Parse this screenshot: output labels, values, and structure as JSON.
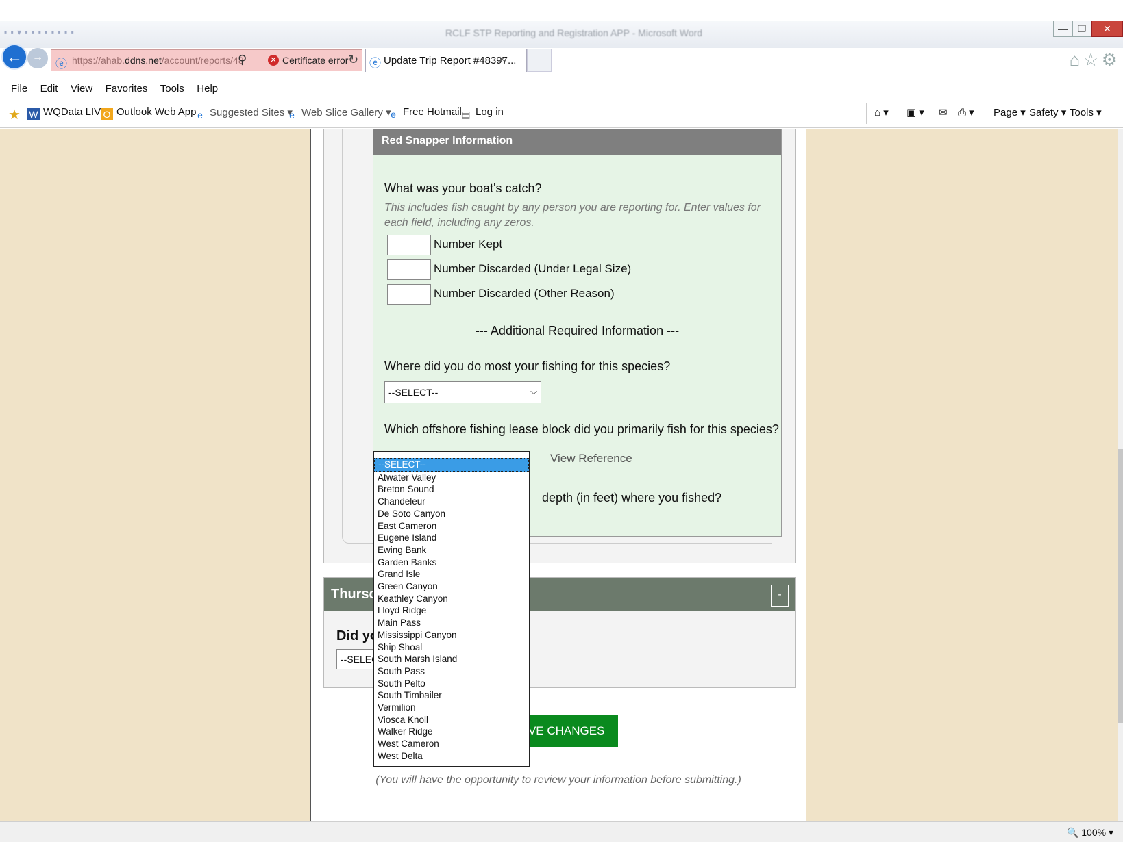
{
  "window": {
    "title": "RCLF STP Reporting and Registration APP - Microsoft Word",
    "buttons": {
      "minimize": "—",
      "restore": "❐",
      "close": "✕"
    }
  },
  "address": {
    "url_host_prefix": "https://ahab.",
    "url_host": "ddns.net",
    "url_path": "/account/reports/48",
    "cert_error": "Certificate error"
  },
  "tab": {
    "label": "Update Trip Report #48397...",
    "close": "×"
  },
  "menu": [
    "File",
    "Edit",
    "View",
    "Favorites",
    "Tools",
    "Help"
  ],
  "favorites": [
    {
      "label": "WQData LIVE",
      "icon": "W"
    },
    {
      "label": "Outlook Web App",
      "icon": "O"
    },
    {
      "label": "Suggested Sites ▾",
      "icon": "e"
    },
    {
      "label": "Web Slice Gallery ▾",
      "icon": "e"
    },
    {
      "label": "Free Hotmail",
      "icon": "e"
    },
    {
      "label": "Log in",
      "icon": "▤"
    }
  ],
  "commands": {
    "page": "Page ▾",
    "safety": "Safety ▾",
    "tools": "Tools ▾"
  },
  "species_panel": {
    "title": "Red Snapper Information",
    "catch_question": "What was your boat's catch?",
    "catch_help": "This includes fish caught by any person you are reporting for. Enter values for each field, including any zeros.",
    "fields": {
      "kept": "Number Kept",
      "discarded_legal": "Number Discarded (Under Legal Size)",
      "discarded_other": "Number Discarded (Other Reason)"
    },
    "additional_header": "--- Additional Required Information ---",
    "area_question": "Where did you do most your fishing for this species?",
    "area_select": "--SELECT--",
    "lease_question": "Which offshore fishing lease block did you primarily fish for this species?",
    "view_reference": "View Reference",
    "depth_question_partial": "depth (in feet) where you fished?"
  },
  "lease_block_options": [
    "--SELECT--",
    "Atwater Valley",
    "Breton Sound",
    "Chandeleur",
    "De Soto Canyon",
    "East Cameron",
    "Eugene Island",
    "Ewing Bank",
    "Garden Banks",
    "Grand Isle",
    "Green Canyon",
    "Keathley Canyon",
    "Lloyd Ridge",
    "Main Pass",
    "Mississippi Canyon",
    "Ship Shoal",
    "South Marsh Island",
    "South Pass",
    "South Pelto",
    "South Timbailer",
    "Vermilion",
    "Viosca Knoll",
    "Walker Ridge",
    "West Cameron",
    "West Delta"
  ],
  "day_panel": {
    "title_partial": "Thursda",
    "collapse": "-",
    "question_partial": "Did you",
    "select_partial": "--SELECT"
  },
  "save_button": "SAVE CHANGES",
  "review_note": "(You will have the opportunity to review your information before submitting.)",
  "status": {
    "zoom": "100%"
  }
}
